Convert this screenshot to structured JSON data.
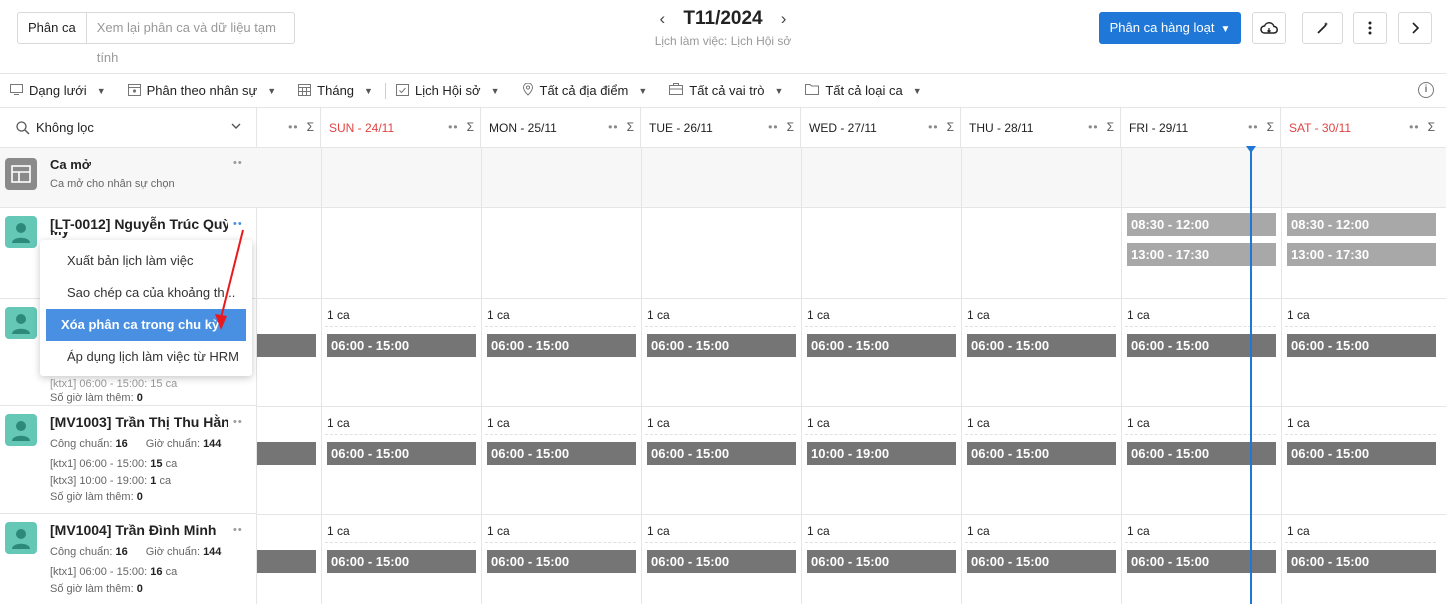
{
  "header": {
    "tab_active": "Phân ca",
    "tab_placeholder": "Xem lại phân ca và dữ liệu tạm tính",
    "period_title": "T11/2024",
    "period_subtitle": "Lịch làm việc: Lịch Hội sở",
    "bulk_button": "Phân ca hàng loạt"
  },
  "toolbar": {
    "view": "Dạng lưới",
    "group": "Phân theo nhân sự",
    "range": "Tháng",
    "schedule": "Lịch Hội sở",
    "location": "Tất cả địa điểm",
    "role": "Tất cả vai trò",
    "shift_type": "Tất cả loại ca"
  },
  "filter": {
    "label": "Không lọc"
  },
  "days": [
    {
      "label": "",
      "weekend": false
    },
    {
      "label": "SUN - 24/11",
      "weekend": true
    },
    {
      "label": "MON - 25/11",
      "weekend": false
    },
    {
      "label": "TUE - 26/11",
      "weekend": false
    },
    {
      "label": "WED - 27/11",
      "weekend": false
    },
    {
      "label": "THU - 28/11",
      "weekend": false
    },
    {
      "label": "FRI - 29/11",
      "weekend": false
    },
    {
      "label": "SAT - 30/11",
      "weekend": true
    }
  ],
  "sum_symbol": "Σ",
  "open_shift": {
    "title": "Ca mở",
    "subtitle": "Ca mở cho nhân sự chọn"
  },
  "employees": [
    {
      "name": "[LT-0012] Nguyễn Trúc Quỳnh My",
      "shifts": {
        "fri": [
          "08:30 - 12:00",
          "13:00 - 17:30"
        ],
        "sat": [
          "08:30 - 12:00",
          "13:00 - 17:30"
        ]
      }
    },
    {
      "name": "",
      "line_ktx": "[ktx1] 06:00 - 15:00:",
      "line_ktx_val": "15 ca",
      "extra_label": "Số giờ làm thêm:",
      "extra_val": "0",
      "count": "1 ca",
      "shift": "06:00 - 15:00"
    },
    {
      "name": "[MV1003] Trần Thị Thu Hằng",
      "std_label": "Công chuẩn:",
      "std_val": "16",
      "hour_label": "Giờ chuẩn:",
      "hour_val": "144",
      "line1": "[ktx1] 06:00 - 15:00:",
      "line1_val": "15",
      "line1_unit": "ca",
      "line2": "[ktx3] 10:00 - 19:00:",
      "line2_val": "1",
      "line2_unit": "ca",
      "extra_label": "Số giờ làm thêm:",
      "extra_val": "0",
      "count": "1 ca",
      "shift": "06:00 - 15:00",
      "wed_shift": "10:00 - 19:00"
    },
    {
      "name": "[MV1004] Trần Đình Minh",
      "std_label": "Công chuẩn:",
      "std_val": "16",
      "hour_label": "Giờ chuẩn:",
      "hour_val": "144",
      "line1": "[ktx1] 06:00 - 15:00:",
      "line1_val": "16",
      "line1_unit": "ca",
      "extra_label": "Số giờ làm thêm:",
      "extra_val": "0",
      "count": "1 ca",
      "shift": "06:00 - 15:00"
    }
  ],
  "context_menu": [
    "Xuất bản lịch làm việc",
    "Sao chép ca của khoảng th...",
    "Xóa phân ca trong chu kỳ",
    "Áp dụng lịch làm việc từ HRM"
  ],
  "colors": {
    "primary": "#1f77d8",
    "shift": "#757575",
    "shift_light": "#a8a8a8",
    "weekend": "#e04343",
    "avatar": "#65c7b6"
  }
}
